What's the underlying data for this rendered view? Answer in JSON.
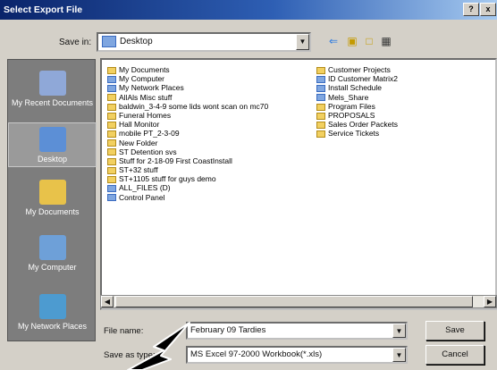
{
  "window": {
    "title": "Select Export File",
    "help": "?",
    "close": "x"
  },
  "toolbar": {
    "save_in_label": "Save in:",
    "save_in_value": "Desktop"
  },
  "places": [
    "My Recent Documents",
    "Desktop",
    "My Documents",
    "My Computer",
    "My Network Places"
  ],
  "files_col1": [
    "My Documents",
    "My Computer",
    "My Network Places",
    "AllAls Misc stuff",
    "baldwin_3-4-9 some lids wont scan on mc70",
    "Funeral Homes",
    "Hall Monitor",
    "mobile PT_2-3-09",
    "New Folder",
    "ST Detention svs",
    "Stuff for 2-18-09 First CoastInstall",
    "ST+32 stuff",
    "ST+1105 stuff for guys demo",
    "ALL_FILES (D)",
    "Control Panel"
  ],
  "files_col2": [
    "Customer Projects",
    "ID Customer Matrix2",
    "Install Schedule",
    "Mels_Share",
    "Program Files",
    "PROPOSALS",
    "Sales Order Packets",
    "Service Tickets"
  ],
  "filename": {
    "label": "File name:",
    "value": "February 09 Tardies"
  },
  "savetype": {
    "label": "Save as type:",
    "value": "MS Excel 97-2000 Workbook(*.xls)"
  },
  "buttons": {
    "save": "Save",
    "cancel": "Cancel"
  },
  "icons": [
    "folder-icon",
    "up-folder-icon",
    "new-folder-icon",
    "views-icon",
    "back-icon"
  ]
}
